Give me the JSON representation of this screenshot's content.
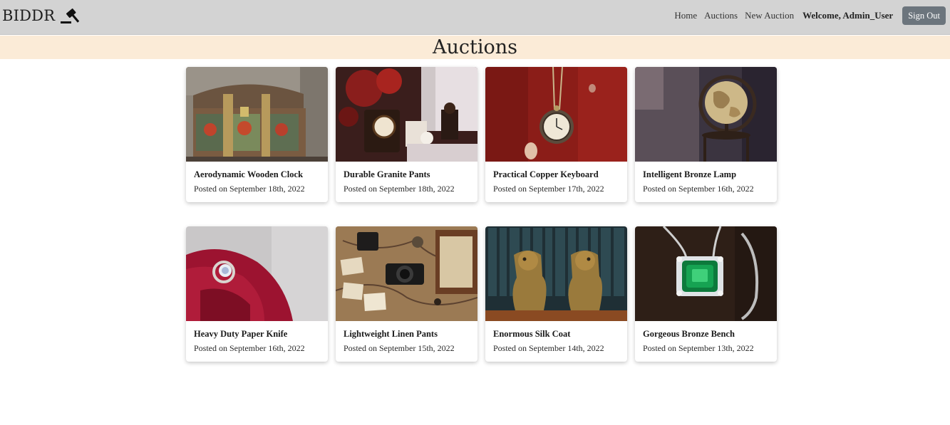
{
  "navbar": {
    "brand": "BIDDR",
    "brand_icon": "gavel-icon",
    "links": [
      "Home",
      "Auctions",
      "New Auction"
    ],
    "welcome": "Welcome, Admin_User",
    "sign_out": "Sign Out"
  },
  "page": {
    "title": "Auctions"
  },
  "auctions": [
    {
      "title": "Aerodynamic Wooden Clock",
      "date": "Posted on September 18th, 2022",
      "image": "painted-wooden-chest"
    },
    {
      "title": "Durable Granite Pants",
      "date": "Posted on September 18th, 2022",
      "image": "antique-clock-and-telephone"
    },
    {
      "title": "Practical Copper Keyboard",
      "date": "Posted on September 17th, 2022",
      "image": "pocket-watch-on-red-coat"
    },
    {
      "title": "Intelligent Bronze Lamp",
      "date": "Posted on September 16th, 2022",
      "image": "antique-globe"
    },
    {
      "title": "Heavy Duty Paper Knife",
      "date": "Posted on September 16th, 2022",
      "image": "diamond-ring-on-rose"
    },
    {
      "title": "Lightweight Linen Pants",
      "date": "Posted on September 15th, 2022",
      "image": "vintage-camera-on-map"
    },
    {
      "title": "Enormous Silk Coat",
      "date": "Posted on September 14th, 2022",
      "image": "bronze-foo-dog-statues"
    },
    {
      "title": "Gorgeous Bronze Bench",
      "date": "Posted on September 13th, 2022",
      "image": "emerald-necklace"
    }
  ]
}
